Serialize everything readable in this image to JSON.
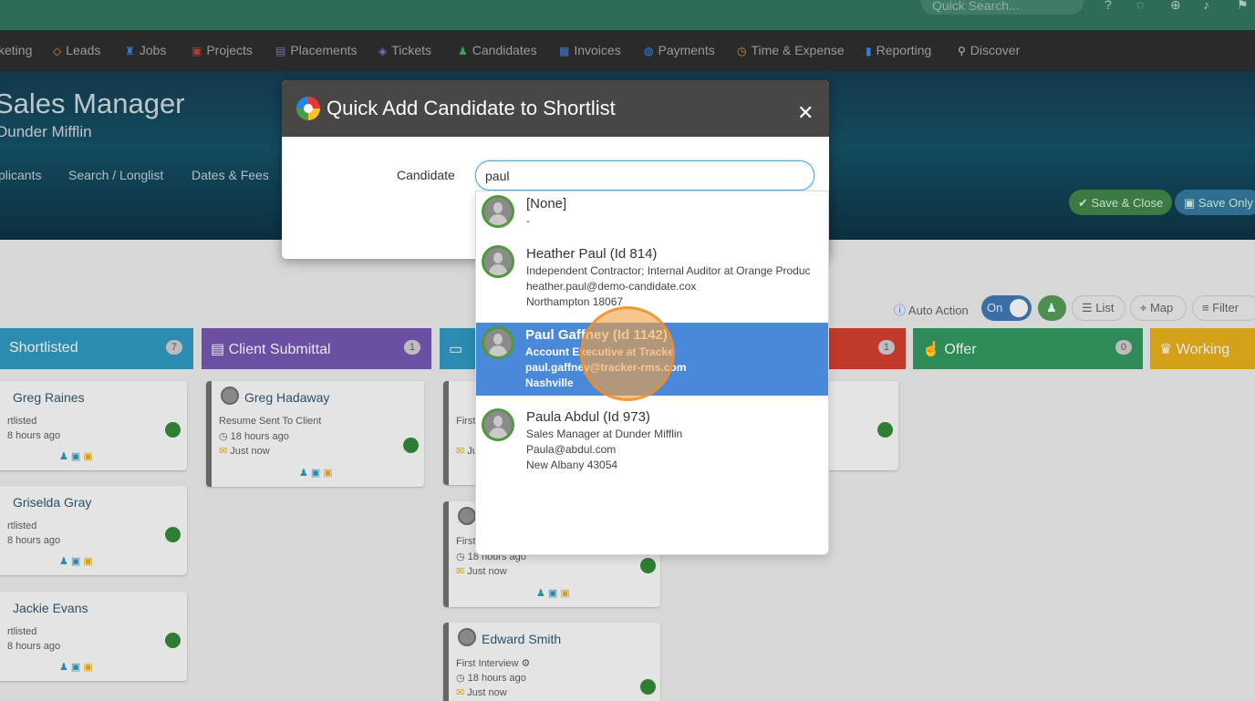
{
  "topbar": {
    "search_placeholder": "Quick Search..."
  },
  "nav": [
    {
      "label": "keting",
      "icon": ""
    },
    {
      "label": "Leads",
      "icon": "diamond-icon"
    },
    {
      "label": "Jobs",
      "icon": "trophy-icon"
    },
    {
      "label": "Projects",
      "icon": "folder-icon"
    },
    {
      "label": "Placements",
      "icon": "suitcase-icon"
    },
    {
      "label": "Tickets",
      "icon": "tag-icon"
    },
    {
      "label": "Candidates",
      "icon": "users-icon"
    },
    {
      "label": "Invoices",
      "icon": "invoice-icon"
    },
    {
      "label": "Payments",
      "icon": "payment-icon"
    },
    {
      "label": "Time & Expense",
      "icon": "clock-icon"
    },
    {
      "label": "Reporting",
      "icon": "chart-icon"
    },
    {
      "label": "Discover",
      "icon": "search-icon"
    }
  ],
  "job": {
    "title": "Sales Manager",
    "company": "Dunder Mifflin"
  },
  "job_tabs": [
    "plicants",
    "Search / Longlist",
    "Dates & Fees"
  ],
  "actions": {
    "save_close": "Save & Close",
    "save_only": "Save Only"
  },
  "controls": {
    "auto_action": "Auto Action",
    "toggle": "On",
    "list": "List",
    "map": "Map",
    "filter": "Filter"
  },
  "columns": [
    {
      "title": "Shortlisted",
      "count": "7",
      "color": "#2b8bb0"
    },
    {
      "title": "Client Submittal",
      "count": "1",
      "color": "#6a4fa3"
    },
    {
      "title": "",
      "count": "",
      "color": "#2b8bb0"
    },
    {
      "title": "",
      "count": "1",
      "color": "#c0392b"
    },
    {
      "title": "Offer",
      "count": "0",
      "color": "#2e8b57"
    },
    {
      "title": "Working",
      "count": "",
      "color": "#d4a017"
    }
  ],
  "cards": {
    "c1": {
      "name": "Greg Raines",
      "status": "rtlisted",
      "time": "8 hours ago"
    },
    "c2": {
      "name": "Griselda Gray",
      "status": "rtlisted",
      "time": "8 hours ago"
    },
    "c3": {
      "name": "Jackie Evans",
      "status": "rtlisted",
      "time": "8 hours ago"
    },
    "c4": {
      "name": "Greg Hadaway",
      "status": "Resume Sent To Client",
      "time": "18 hours ago",
      "note": "Just now"
    },
    "c5": {
      "status": "First",
      "note": "Just now"
    },
    "c6": {
      "status": "First",
      "time": "18 hours ago",
      "note": "Just now"
    },
    "c7": {
      "name": "Edward Smith",
      "status": "First Interview",
      "time": "18 hours ago",
      "note": "Just now"
    }
  },
  "modal": {
    "title": "Quick Add Candidate to Shortlist",
    "close": "✕",
    "label": "Candidate",
    "input_value": "paul"
  },
  "options": [
    {
      "title": "[None]",
      "lines": [
        "-"
      ]
    },
    {
      "title": "Heather Paul (Id 814)",
      "lines": [
        "Independent Contractor; Internal Auditor at Orange Produc",
        "heather.paul@demo-candidate.cox",
        "Northampton 18067"
      ]
    },
    {
      "title": "Paul Gaffney (Id 1142)",
      "lines": [
        "Account Executive at Tracke",
        "paul.gaffney@tracker-rms.com",
        "Nashville"
      ]
    },
    {
      "title": "Paula Abdul (Id 973)",
      "lines": [
        "Sales Manager at Dunder Mifflin",
        "Paula@abdul.com",
        "New Albany 43054"
      ]
    }
  ]
}
